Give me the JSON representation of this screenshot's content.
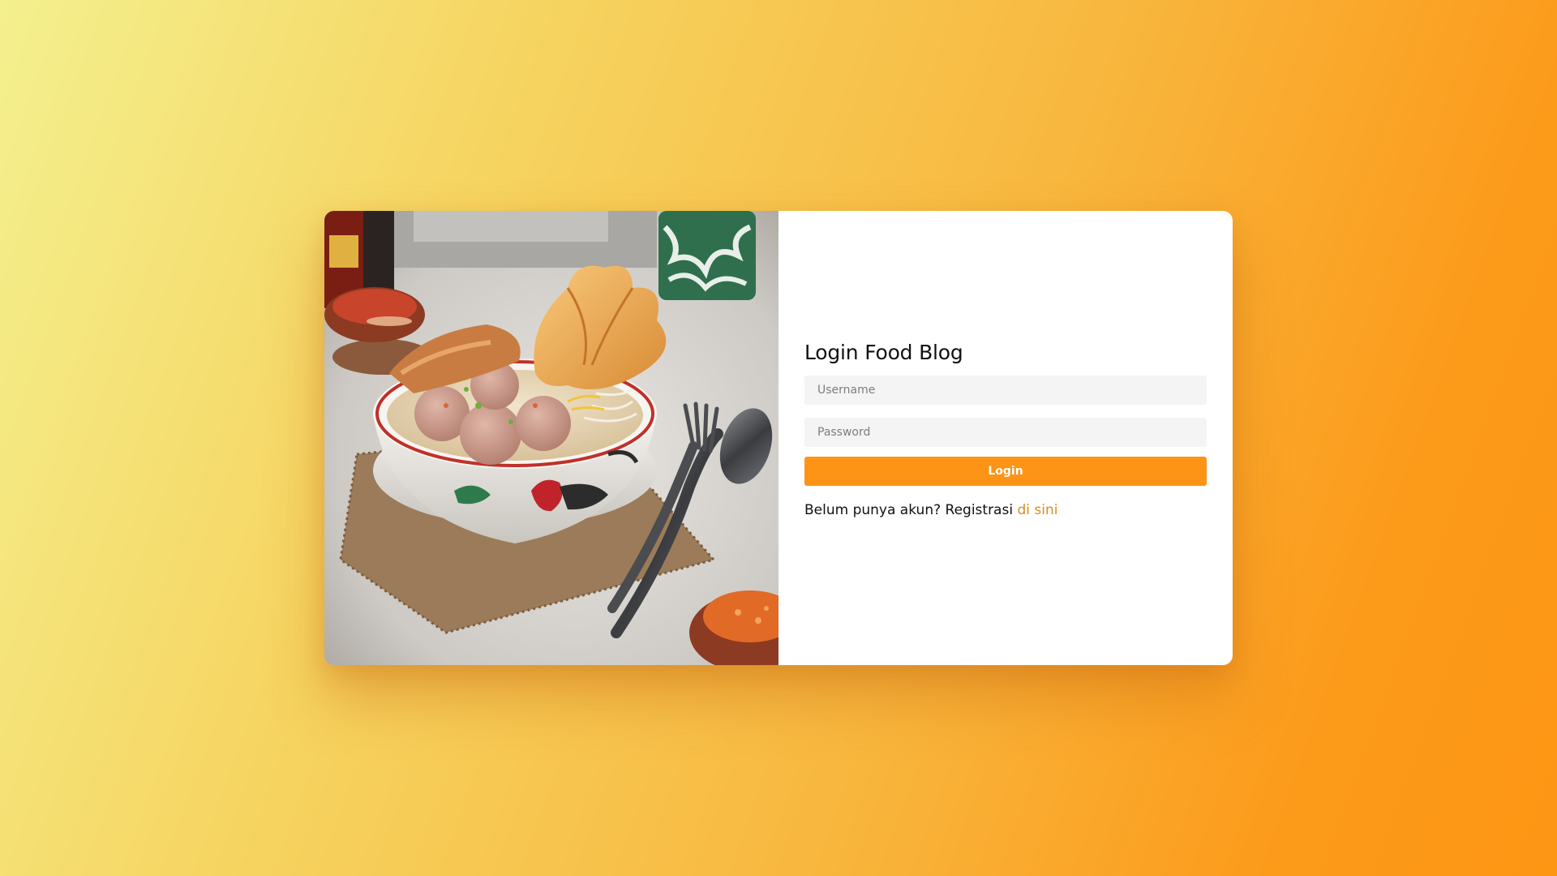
{
  "login": {
    "title": "Login Food Blog",
    "username_placeholder": "Username",
    "password_placeholder": "Password",
    "button_label": "Login",
    "register_prompt": "Belum punya akun? Registrasi",
    "register_link": "di sini"
  },
  "colors": {
    "accent": "#fd9415",
    "link": "#e08a1e",
    "background_start": "#f4f08e",
    "background_end": "#fd9613"
  },
  "image": {
    "name": "food-photo"
  }
}
